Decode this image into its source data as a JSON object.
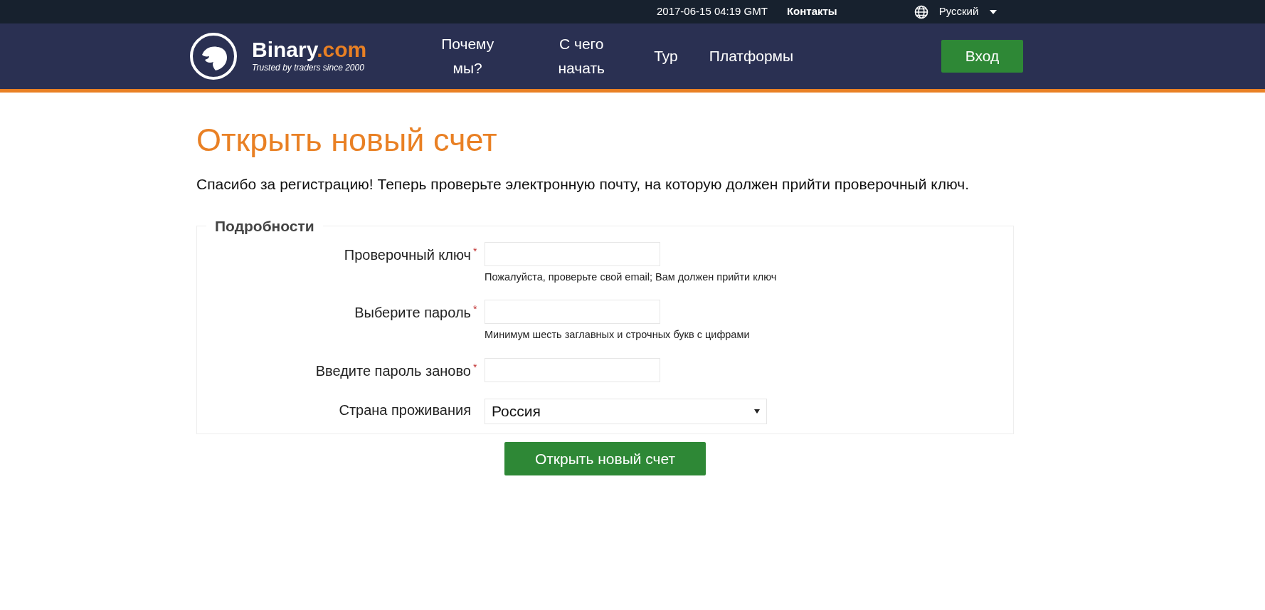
{
  "top_bar": {
    "datetime": "2017-06-15 04:19 GMT",
    "contacts_link": "Контакты",
    "language": "Русский"
  },
  "header": {
    "logo": {
      "name": "Binary",
      "suffix": ".com",
      "tagline": "Trusted by traders since 2000"
    },
    "nav": [
      {
        "label": "Почему мы?"
      },
      {
        "label": "С чего начать"
      },
      {
        "label": "Тур"
      },
      {
        "label": "Платформы"
      }
    ],
    "login_button": "Вход"
  },
  "page": {
    "title": "Открыть новый счет",
    "message": "Спасибо за регистрацию! Теперь проверьте электронную почту, на которую должен прийти проверочный ключ.",
    "fieldset": {
      "legend": "Подробности",
      "fields": [
        {
          "kind": "input",
          "label": "Проверочный ключ",
          "required_mark": "*",
          "hint": "Пожалуйста, проверьте свой email; Вам должен прийти ключ"
        },
        {
          "kind": "input",
          "label": "Выберите пароль",
          "required_mark": "*",
          "hint": "Минимум шесть заглавных и строчных букв с цифрами"
        },
        {
          "kind": "input",
          "label": "Введите пароль заново",
          "required_mark": "*"
        },
        {
          "kind": "select",
          "label": "Страна проживания",
          "value": "Россия"
        }
      ]
    },
    "submit_button": "Открыть новый счет"
  }
}
